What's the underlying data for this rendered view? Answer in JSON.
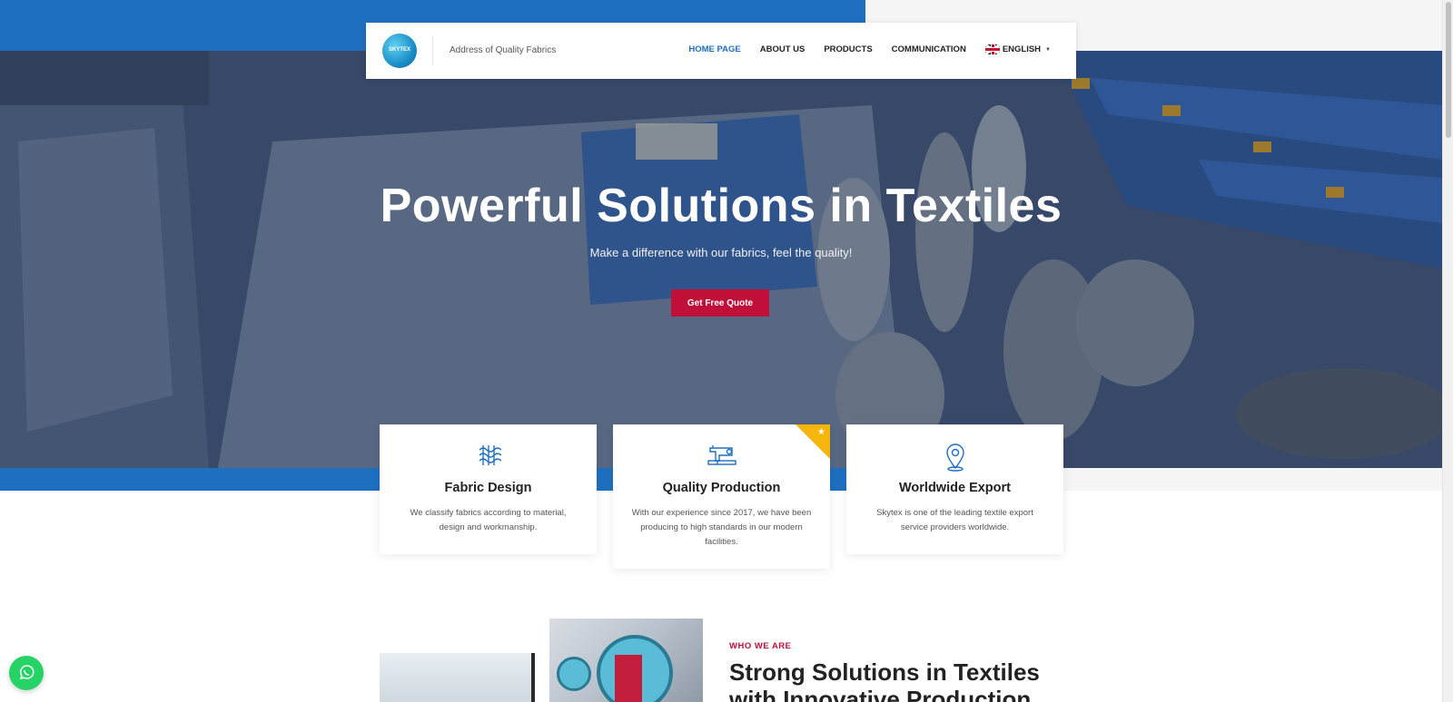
{
  "header": {
    "logo_text": "SKYTEX",
    "tagline": "Address of Quality Fabrics",
    "nav": [
      {
        "label": "HOME PAGE",
        "active": true
      },
      {
        "label": "ABOUT US"
      },
      {
        "label": "PRODUCTS"
      },
      {
        "label": "COMMUNICATION"
      }
    ],
    "language": "ENGLISH"
  },
  "hero": {
    "title": "Powerful Solutions in Textiles",
    "subtitle": "Make a difference with our fabrics, feel the quality!",
    "cta_label": "Get Free Quote"
  },
  "features": [
    {
      "icon": "fabric-icon",
      "title": "Fabric Design",
      "text": "We classify fabrics according to material, design and workmanship."
    },
    {
      "icon": "sewing-machine-icon",
      "title": "Quality Production",
      "text": "With our experience since 2017, we have been producing to high standards in our modern facilities.",
      "badge_icon": "star-icon"
    },
    {
      "icon": "location-pin-icon",
      "title": "Worldwide Export",
      "text": "Skytex is one of the leading textile export service providers worldwide."
    }
  ],
  "about": {
    "eyebrow": "WHO WE ARE",
    "title": "Strong Solutions in Textiles with Innovative Production"
  },
  "colors": {
    "brand_blue": "#1f6fc0",
    "cta_red": "#c0103a",
    "badge_yellow": "#f5b50a",
    "whatsapp_green": "#25d366"
  }
}
